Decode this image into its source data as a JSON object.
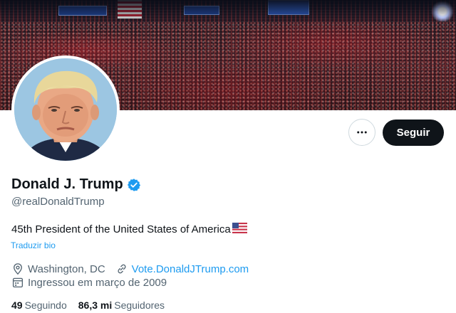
{
  "profile": {
    "name": "Donald J. Trump",
    "handle": "@realDonaldTrump",
    "bio": "45th President of the United States of America",
    "translate_label": "Traduzir bio",
    "location": "Washington, DC",
    "website": "Vote.DonaldJTrump.com",
    "joined": "Ingressou em março de 2009"
  },
  "actions": {
    "follow_label": "Seguir",
    "more_icon": "more-horizontal-icon"
  },
  "stats": {
    "following_count": "49",
    "following_label": "Seguindo",
    "followers_count": "86,3 mi",
    "followers_label": "Seguidores"
  },
  "icons": {
    "verified": "verified-badge-icon",
    "location": "location-pin-icon",
    "link": "link-icon",
    "calendar": "calendar-icon",
    "flag": "us-flag-icon"
  },
  "colors": {
    "accent": "#1d9bf0",
    "text": "#0f1419",
    "secondary": "#536471",
    "follow_button": "#0f1419"
  }
}
